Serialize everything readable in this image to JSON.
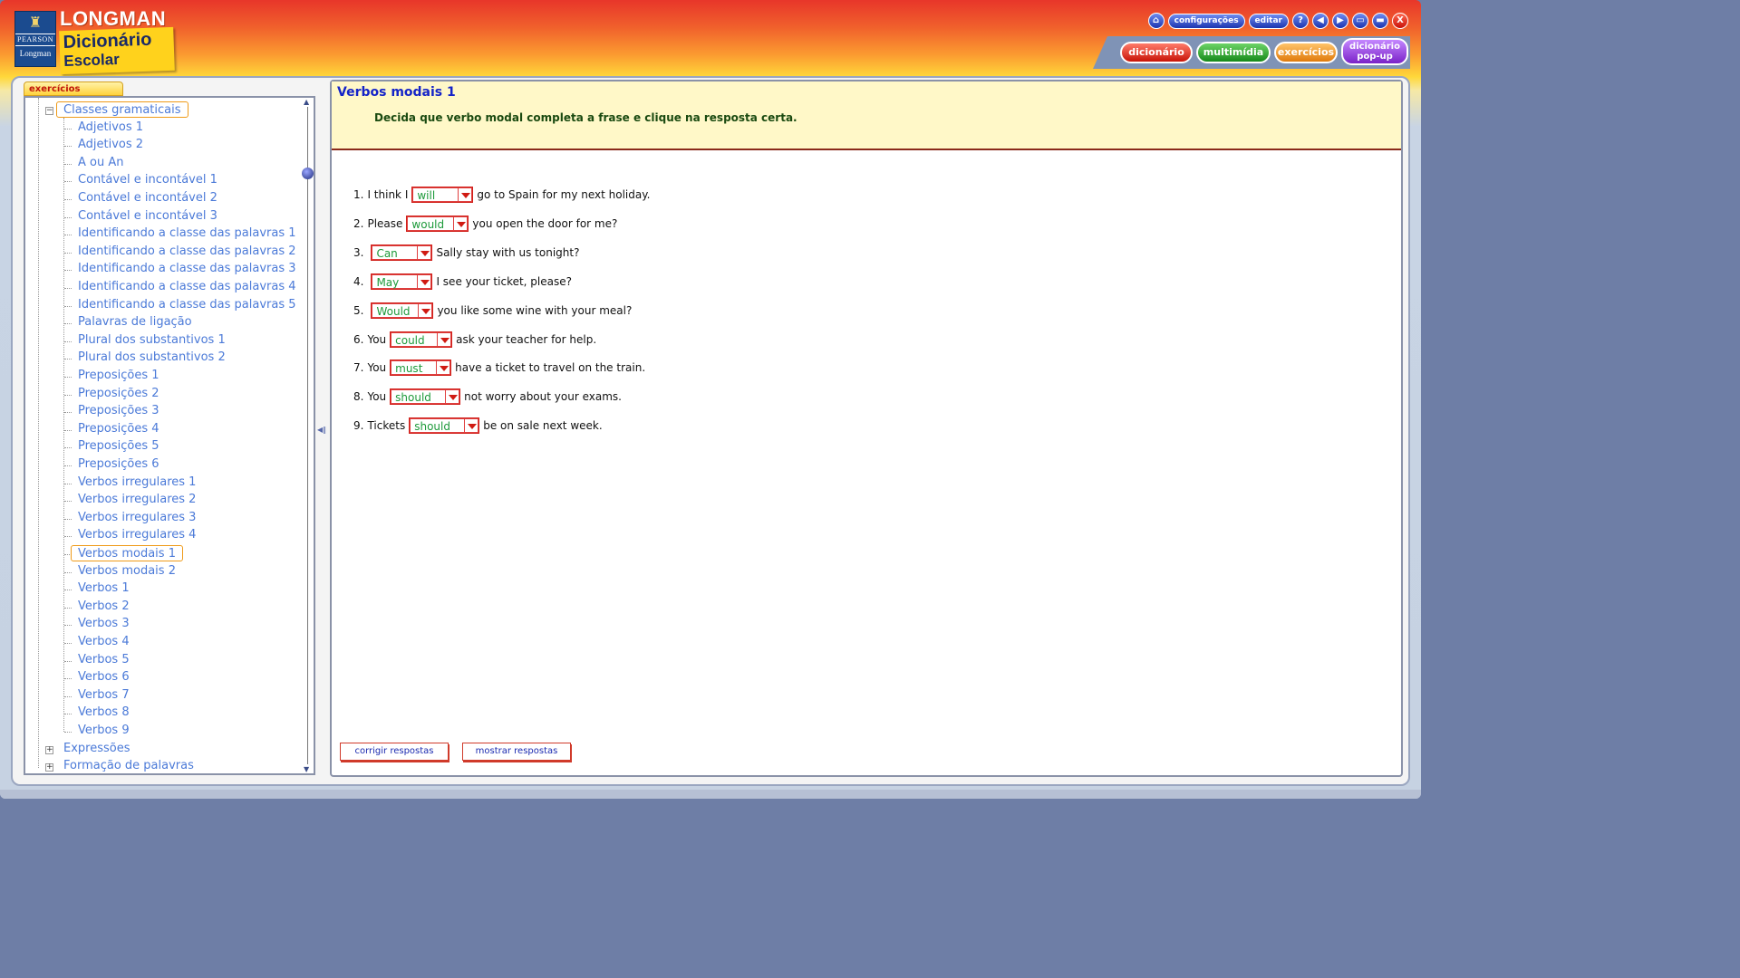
{
  "brand": {
    "publisher_top": "PEARSON",
    "publisher_bottom": "Longman",
    "title": "LONGMAN",
    "subtitle_line1": "Dicionário",
    "subtitle_line2": "Escolar"
  },
  "toolbar": {
    "home_icon": "home-icon",
    "settings_label": "configurações",
    "edit_label": "editar",
    "help_label": "?",
    "back_label": "◀",
    "forward_label": "▶",
    "window1_label": "▭",
    "window2_label": "▬",
    "close_label": "X"
  },
  "main_tabs": {
    "dictionary": "dicionário",
    "multimedia": "multimídia",
    "exercises": "exercícios",
    "popup_line1": "dicionário",
    "popup_line2": "pop-up"
  },
  "sidebar": {
    "tab_label": "exercícios",
    "root_group": "Classes gramaticais",
    "items": [
      "Adjetivos 1",
      "Adjetivos 2",
      "A ou An",
      "Contável e incontável 1",
      "Contável e incontável 2",
      "Contável e incontável 3",
      "Identificando a classe das palavras 1",
      "Identificando a classe das palavras 2",
      "Identificando a classe das palavras 3",
      "Identificando a classe das palavras 4",
      "Identificando a classe das palavras 5",
      "Palavras de ligação",
      "Plural dos substantivos 1",
      "Plural dos substantivos 2",
      "Preposições 1",
      "Preposições 2",
      "Preposições 3",
      "Preposições 4",
      "Preposições 5",
      "Preposições 6",
      "Verbos irregulares 1",
      "Verbos irregulares 2",
      "Verbos irregulares 3",
      "Verbos irregulares 4",
      "Verbos modais 1",
      "Verbos modais 2",
      "Verbos 1",
      "Verbos 2",
      "Verbos 3",
      "Verbos 4",
      "Verbos 5",
      "Verbos 6",
      "Verbos 7",
      "Verbos 8",
      "Verbos 9"
    ],
    "selected_item": "Verbos modais 1",
    "other_groups": [
      "Expressões",
      "Formação de palavras"
    ]
  },
  "exercise": {
    "title": "Verbos modais 1",
    "instruction": "Decida que verbo modal completa a frase e clique na resposta certa.",
    "questions": [
      {
        "num": "1.",
        "before": "I think I",
        "answer": "will",
        "after": "go to Spain for my next holiday."
      },
      {
        "num": "2.",
        "before": "Please",
        "answer": "would",
        "after": "you open the door for me?"
      },
      {
        "num": "3.",
        "before": "",
        "answer": "Can",
        "after": "Sally stay with us tonight?"
      },
      {
        "num": "4.",
        "before": "",
        "answer": "May",
        "after": "I see your ticket, please?"
      },
      {
        "num": "5.",
        "before": "",
        "answer": "Would",
        "after": "you like some wine with your meal?"
      },
      {
        "num": "6.",
        "before": "You",
        "answer": "could",
        "after": "ask your teacher for help."
      },
      {
        "num": "7.",
        "before": "You",
        "answer": "must",
        "after": "have a ticket to travel on the train."
      },
      {
        "num": "8.",
        "before": "You",
        "answer": "should",
        "after": "not worry about your exams."
      },
      {
        "num": "9.",
        "before": "Tickets",
        "answer": "should",
        "after": "be on sale next week."
      }
    ],
    "check_label": "corrigir respostas",
    "show_label": "mostrar respostas"
  },
  "colors": {
    "link_blue": "#4b7ad8",
    "answer_green": "#1d9a3a",
    "title_blue": "#1423c8",
    "selection_orange": "#ef9a18"
  }
}
